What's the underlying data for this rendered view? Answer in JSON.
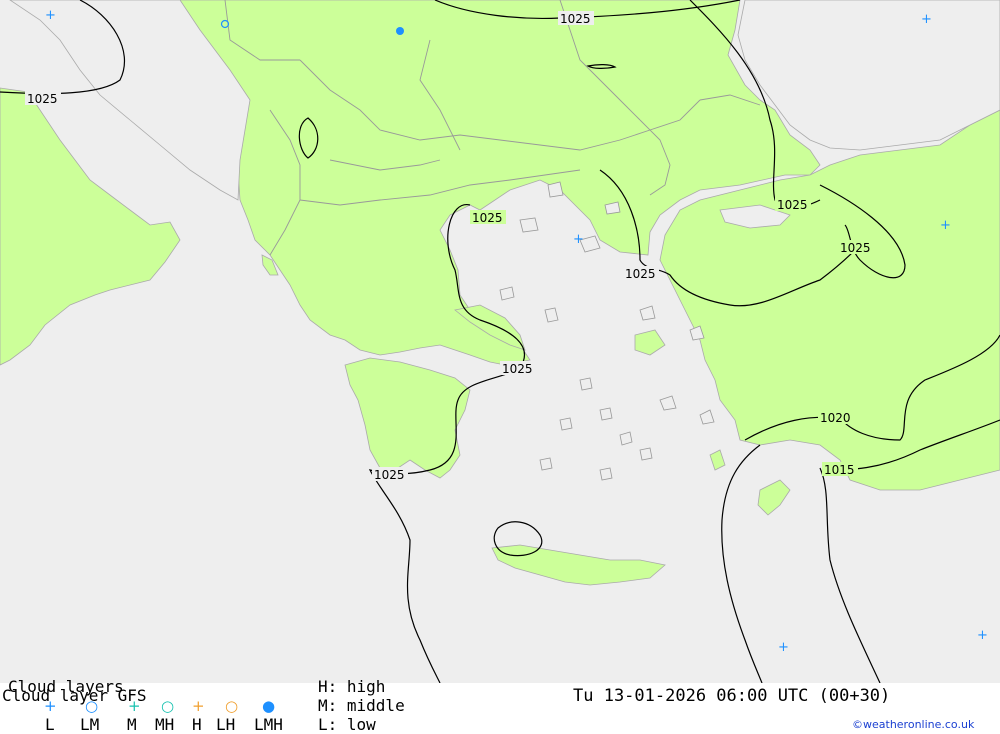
{
  "map": {
    "isobar_labels": [
      "1025",
      "1025",
      "1025",
      "1025",
      "1025",
      "1025",
      "1025",
      "1025",
      "1020",
      "1015"
    ]
  },
  "legend": {
    "title_top": "Cloud layers",
    "title_bottom": "Cloud layer   GFS",
    "symbols": [
      {
        "label": "L",
        "glyph": "+",
        "color": "#1e90ff"
      },
      {
        "label": "LM",
        "glyph": "○",
        "color": "#1e90ff"
      },
      {
        "label": "M",
        "glyph": "+",
        "color": "#19c2b0"
      },
      {
        "label": "MH",
        "glyph": "○",
        "color": "#19c2b0"
      },
      {
        "label": "H",
        "glyph": "+",
        "color": "#f0a030"
      },
      {
        "label": "LH",
        "glyph": "○",
        "color": "#f0a030"
      },
      {
        "label": "LMH",
        "glyph": "●",
        "color": "#1e90ff"
      }
    ],
    "key_high": "H: high",
    "key_middle": "M: middle",
    "key_low": "L: low",
    "datetime": "Tu 13-01-2026 06:00 UTC (00+30)",
    "credit": "©weatheronline.co.uk"
  },
  "colors": {
    "land": "#ccff99",
    "sea": "#eeeeee",
    "border": "#999999",
    "isobar": "#000000"
  }
}
